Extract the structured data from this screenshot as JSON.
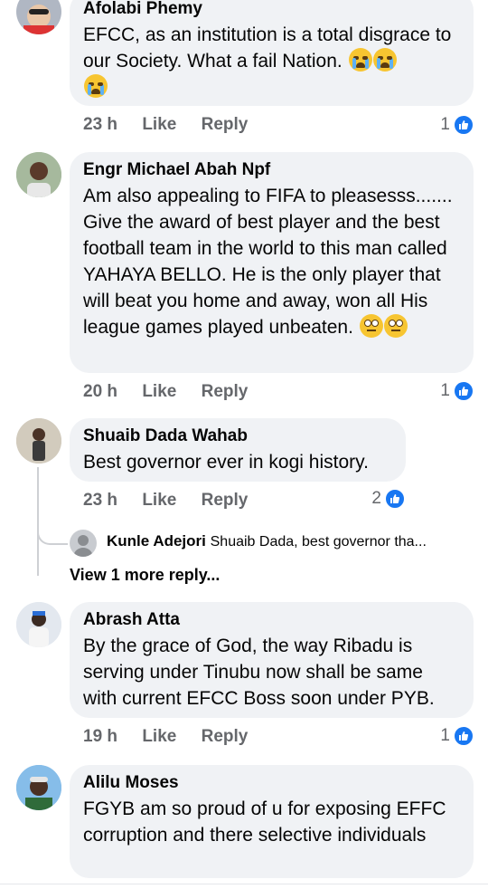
{
  "comments": [
    {
      "name": "Afolabi Phemy",
      "text": "EFCC, as an institution is a total disgrace to our Society. What a fail Nation.",
      "emoji": "crying-face",
      "time": "23 h",
      "like": "Like",
      "reply": "Reply",
      "reactions": "1"
    },
    {
      "name": "Engr Michael Abah Npf",
      "text": "Am also appealing to FIFA to pleasesss....... Give the award of best player and the best football team in the world to this man called YAHAYA BELLO. He is the only player that will beat you home and away, won all  His league games played unbeaten.",
      "emoji": "face-with-rolling-eyes",
      "time": "20 h",
      "like": "Like",
      "reply": "Reply",
      "reactions": "1"
    },
    {
      "name": "Shuaib Dada Wahab",
      "text": "Best governor ever in kogi history.",
      "time": "23 h",
      "like": "Like",
      "reply": "Reply",
      "reactions": "2",
      "nested_reply": {
        "name": "Kunle Adejori",
        "text": "Shuaib Dada, best governor tha..."
      },
      "more_replies": "View 1 more reply..."
    },
    {
      "name": "Abrash Atta",
      "text": "By the grace of God, the way Ribadu is serving under Tinubu now shall be same with current EFCC Boss soon under PYB.",
      "time": "19 h",
      "like": "Like",
      "reply": "Reply",
      "reactions": "1"
    },
    {
      "name": "Alilu Moses",
      "text": "FGYB am so proud of u for exposing EFFC corruption and there selective individuals"
    }
  ],
  "colors": {
    "like_blue": "#1877f2",
    "bubble": "#f0f2f5",
    "meta": "#65676b"
  }
}
